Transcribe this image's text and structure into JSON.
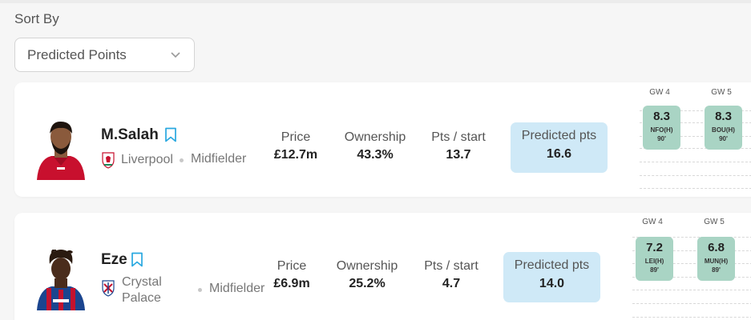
{
  "sort": {
    "label": "Sort By",
    "selected": "Predicted Points"
  },
  "players": [
    {
      "name": "M.Salah",
      "club_line1": "Liverpool",
      "club_line2": "",
      "position": "Midfielder",
      "stats": {
        "price_label": "Price",
        "price": "£12.7m",
        "ownership_label": "Ownership",
        "ownership": "43.3%",
        "pts_label": "Pts / start",
        "pts": "13.7",
        "pred_label": "Predicted pts",
        "pred": "16.6"
      },
      "gameweeks": [
        {
          "gw": "GW 4",
          "points": "8.3",
          "opponent": "NFO(H)",
          "minutes": "90'"
        },
        {
          "gw": "GW 5",
          "points": "8.3",
          "opponent": "BOU(H)",
          "minutes": "90'"
        }
      ]
    },
    {
      "name": "Eze",
      "club_line1": "Crystal",
      "club_line2": "Palace",
      "position": "Midfielder",
      "stats": {
        "price_label": "Price",
        "price": "£6.9m",
        "ownership_label": "Ownership",
        "ownership": "25.2%",
        "pts_label": "Pts / start",
        "pts": "4.7",
        "pred_label": "Predicted pts",
        "pred": "14.0"
      },
      "gameweeks": [
        {
          "gw": "GW 4",
          "points": "7.2",
          "opponent": "LEI(H)",
          "minutes": "89'"
        },
        {
          "gw": "GW 5",
          "points": "6.8",
          "opponent": "MUN(H)",
          "minutes": "89'"
        }
      ]
    }
  ],
  "colors": {
    "predicted_bg": "#cfe9f7",
    "fixture_bg": "#a9d4c4",
    "bookmark": "#29a8e0",
    "liverpool_red": "#c8102e",
    "palace_blue": "#1b458f"
  },
  "icons": {
    "sort_chevron": "chevron-down-icon",
    "bookmark": "bookmark-icon",
    "liverpool_badge": "liverpool-crest-icon",
    "palace_badge": "crystal-palace-crest-icon"
  }
}
